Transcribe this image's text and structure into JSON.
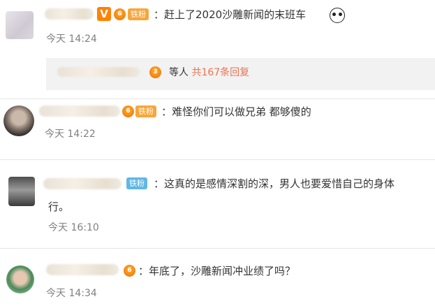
{
  "comments": [
    {
      "text": "：赶上了2020沙雕新闻的末班车",
      "time": "今天 14:24",
      "fan_badge": "铁粉",
      "verified_badge": "V",
      "vip_level": "6",
      "emoji": "panda-face-icon"
    },
    {
      "text": "：难怪你们可以做兄弟 都够傻的",
      "time": "今天 14:22",
      "fan_badge": "铁粉",
      "vip_level": "6"
    },
    {
      "text_line1": "：这真的是感情深割的深，男人也要爱惜自己的身体",
      "text_line2": "行。",
      "time": "今天 16:10",
      "fan_badge": "铁粉"
    },
    {
      "text": "：年底了，沙雕新闻冲业绩了吗？",
      "time": "今天 14:34",
      "vip_level": "6"
    }
  ],
  "reply_summary": {
    "prefix": "等人",
    "link": "共167条回复",
    "vip_level": "3"
  },
  "colors": {
    "text": "#333333",
    "time": "#808080",
    "link": "#eb7350",
    "fan_orange": "#f7a63a",
    "fan_blue": "#5fb7e6",
    "verified": "#ff8200"
  }
}
